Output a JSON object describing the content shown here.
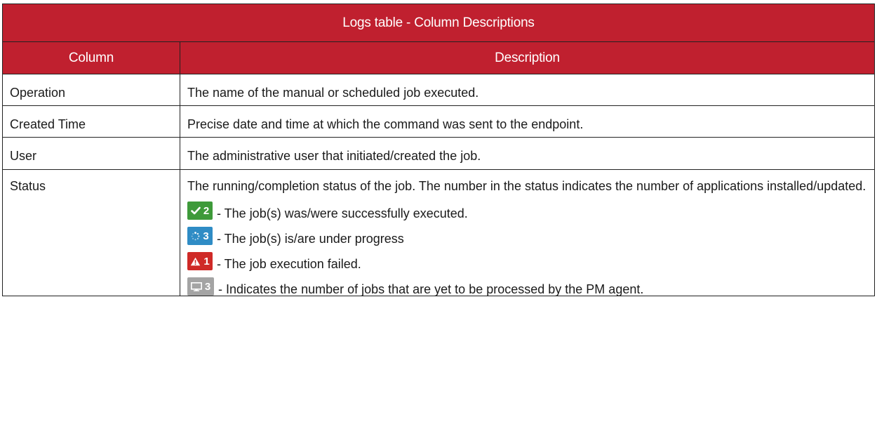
{
  "table": {
    "title": "Logs table - Column Descriptions",
    "headers": {
      "column": "Column",
      "description": "Description"
    },
    "rows": [
      {
        "column": "Operation",
        "description": "The name of the manual or scheduled job executed."
      },
      {
        "column": "Created Time",
        "description": "Precise date and time at which the command was sent to the endpoint."
      },
      {
        "column": "User",
        "description": "The administrative user that initiated/created the job."
      },
      {
        "column": "Status",
        "description": "The running/completion status of the job. The number in the status indicates the number of applications installed/updated."
      }
    ],
    "status_items": [
      {
        "icon": "check-icon",
        "count": "2",
        "color": "#3e9a3a",
        "text": "- The job(s) was/were successfully executed."
      },
      {
        "icon": "spinner-icon",
        "count": "3",
        "color": "#2f8cc5",
        "text": "- The job(s) is/are under progress"
      },
      {
        "icon": "warning-icon",
        "count": "1",
        "color": "#cf2a27",
        "text": "- The job execution failed."
      },
      {
        "icon": "monitor-icon",
        "count": "3",
        "color": "#a4a4a4",
        "text": "- Indicates the number of jobs that are yet to be processed by the PM agent."
      }
    ]
  },
  "colors": {
    "header_bg": "#c0202f",
    "header_text": "#ffffff"
  }
}
